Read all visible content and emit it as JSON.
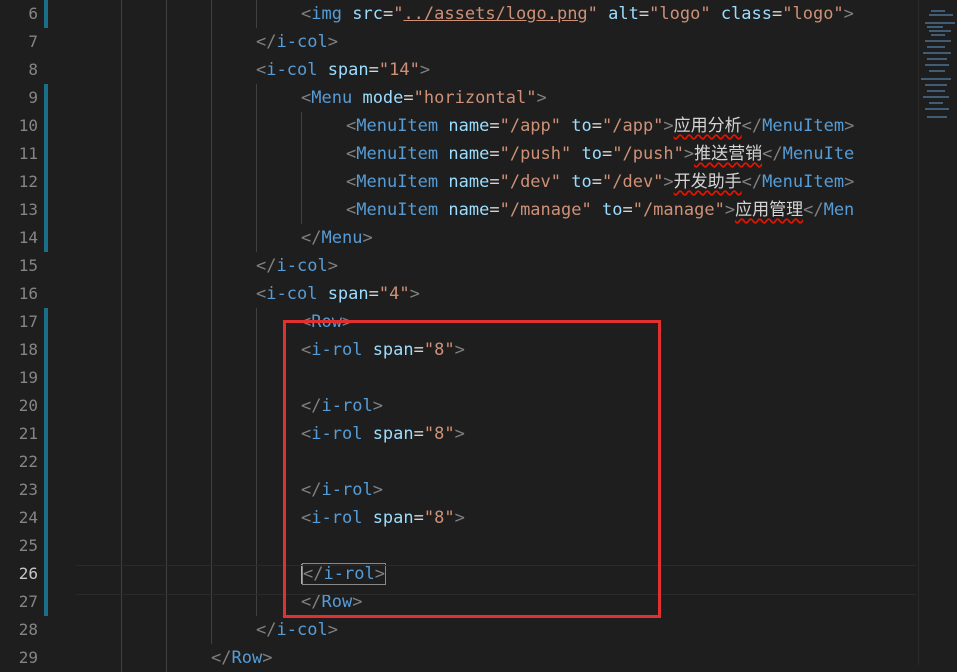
{
  "editor": {
    "lines": [
      {
        "n": "6",
        "text": "<img src=\"../assets/logo.png\" alt=\"logo\" class=\"logo\">"
      },
      {
        "n": "7",
        "text": "</i-col>"
      },
      {
        "n": "8",
        "text": "<i-col span=\"14\">"
      },
      {
        "n": "9",
        "text": "<Menu mode=\"horizontal\">"
      },
      {
        "n": "10",
        "text": "<MenuItem name=\"/app\" to=\"/app\">应用分析</MenuItem>"
      },
      {
        "n": "11",
        "text": "<MenuItem name=\"/push\" to=\"/push\">推送营销</MenuIte"
      },
      {
        "n": "12",
        "text": "<MenuItem name=\"/dev\" to=\"/dev\">开发助手</MenuItem>"
      },
      {
        "n": "13",
        "text": "<MenuItem name=\"/manage\" to=\"/manage\">应用管理</Men"
      },
      {
        "n": "14",
        "text": "</Menu>"
      },
      {
        "n": "15",
        "text": "</i-col>"
      },
      {
        "n": "16",
        "text": "<i-col span=\"4\">"
      },
      {
        "n": "17",
        "text": "<Row>"
      },
      {
        "n": "18",
        "text": "<i-rol span=\"8\">"
      },
      {
        "n": "19",
        "text": ""
      },
      {
        "n": "20",
        "text": "</i-rol>"
      },
      {
        "n": "21",
        "text": "<i-rol span=\"8\">"
      },
      {
        "n": "22",
        "text": ""
      },
      {
        "n": "23",
        "text": "</i-rol>"
      },
      {
        "n": "24",
        "text": "<i-rol span=\"8\">"
      },
      {
        "n": "25",
        "text": ""
      },
      {
        "n": "26",
        "text": "</i-rol>"
      },
      {
        "n": "27",
        "text": "</Row>"
      },
      {
        "n": "28",
        "text": "</i-col>"
      },
      {
        "n": "29",
        "text": "</Row>"
      }
    ],
    "active_line": "26"
  },
  "colors": {
    "background": "#1e1e1e",
    "tag": "#569cd6",
    "attribute": "#9cdcfe",
    "string": "#ce9178",
    "punctuation": "#808080",
    "highlight_box": "#e03030",
    "git_modified": "#1b6e8a"
  }
}
